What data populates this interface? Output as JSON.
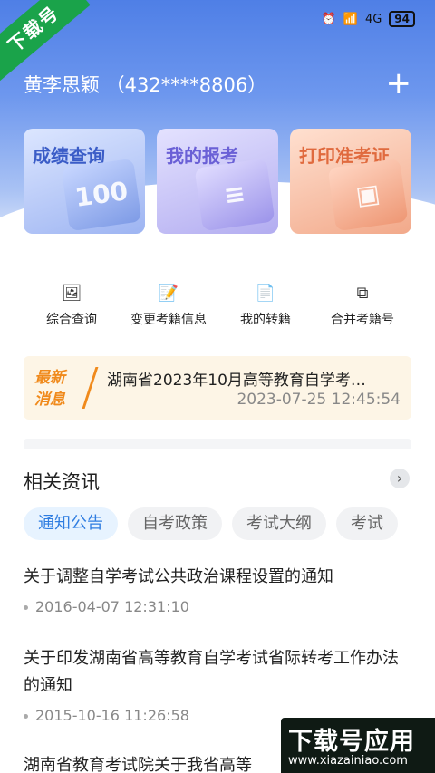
{
  "status": {
    "alarm_icon": "alarm-icon",
    "wifi_icon": "wifi-icon",
    "signal": "4G",
    "battery": "94"
  },
  "badge": {
    "text": "下载号"
  },
  "header": {
    "user": "黄李思颖 （432****8806）",
    "plus_icon": "plus-icon"
  },
  "cards": [
    {
      "title": "成绩查询",
      "art": "100"
    },
    {
      "title": "我的报考",
      "art": "≡"
    },
    {
      "title": "打印准考证",
      "art": "▣"
    }
  ],
  "quick": [
    {
      "label": "综合查询",
      "icon": "image-icon"
    },
    {
      "label": "变更考籍信息",
      "icon": "edit-doc-icon"
    },
    {
      "label": "我的转籍",
      "icon": "transfer-doc-icon"
    },
    {
      "label": "合并考籍号",
      "icon": "merge-icon"
    }
  ],
  "news": {
    "tag_line1": "最新",
    "tag_line2": "消息",
    "title": "湖南省2023年10月高等教育自学考…",
    "time": "2023-07-25 12:45:54"
  },
  "section": {
    "title": "相关资讯",
    "more_icon": "chevron-right-icon"
  },
  "tabs": [
    {
      "label": "通知公告",
      "active": true
    },
    {
      "label": "自考政策",
      "active": false
    },
    {
      "label": "考试大纲",
      "active": false
    },
    {
      "label": "考试",
      "active": false
    }
  ],
  "articles": [
    {
      "title": "关于调整自学考试公共政治课程设置的通知",
      "time": "2016-04-07 12:31:10"
    },
    {
      "title": "关于印发湖南省高等教育自学考试省际转考工作办法的通知",
      "time": "2015-10-16 11:26:58"
    },
    {
      "title": "湖南省教育考试院关于我省高等",
      "time": ""
    }
  ],
  "watermark": {
    "main": "下载号应用",
    "url": "www.xiazainiao.com"
  },
  "colors": {
    "accent": "#2f7de1",
    "news_orange": "#f08a1c",
    "hero_blue": "#4f7fe6"
  }
}
